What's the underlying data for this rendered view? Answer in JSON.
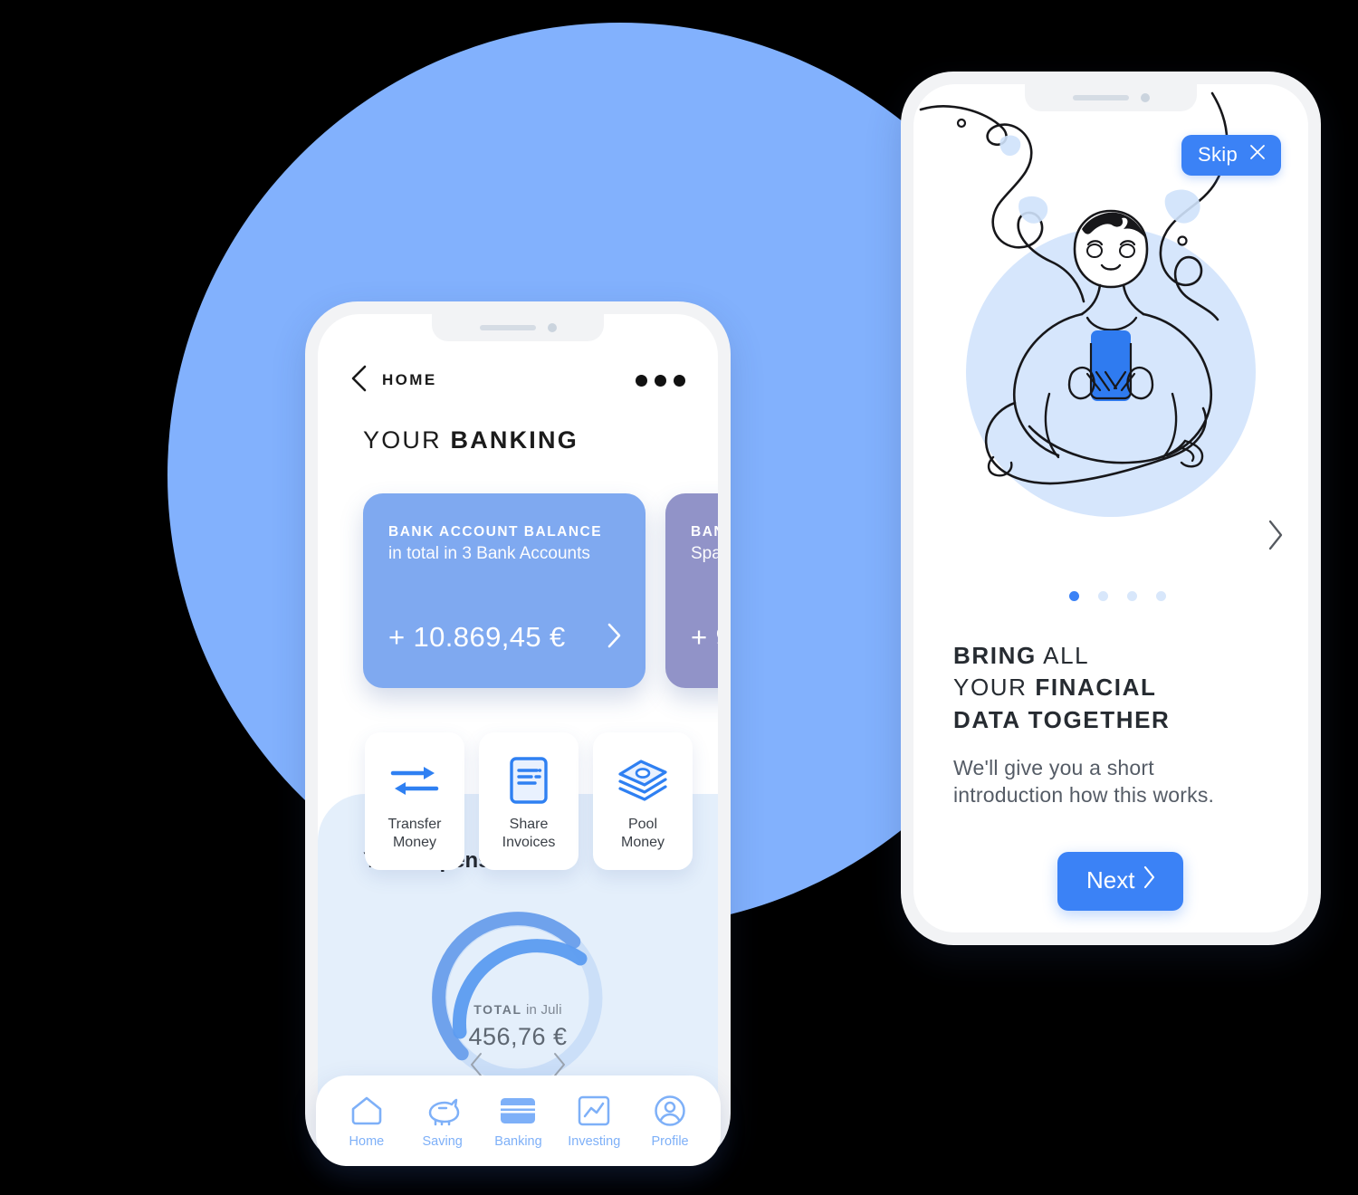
{
  "colors": {
    "bg_circle": "#82B1FD",
    "card_blue": "#7FA9F0",
    "card_purple": "#9193C8",
    "accent_blue": "#3B82F6",
    "nav_blue": "#7EB0F8",
    "panel_light": "#E4EFFB"
  },
  "left_phone": {
    "topbar": {
      "back_icon": "chevron-left-icon",
      "title": "HOME",
      "menu_icon": "more-dots-icon"
    },
    "section_heading": {
      "light": "YOUR",
      "bold": "BANKING"
    },
    "cards": [
      {
        "title": "BANK ACCOUNT BALANCE",
        "subtitle": "in total in 3 Bank Accounts",
        "amount": "+ 10.869,45 €",
        "arrow_icon": "chevron-right-icon",
        "color": "#7FA9F0"
      },
      {
        "title": "BAN",
        "subtitle": "Spa",
        "amount": "+ 9",
        "arrow_icon": "chevron-right-icon",
        "color": "#9193C8"
      }
    ],
    "actions": [
      {
        "icon": "transfer-arrows-icon",
        "line1": "Transfer",
        "line2": "Money"
      },
      {
        "icon": "invoice-document-icon",
        "line1": "Share",
        "line2": "Invoices"
      },
      {
        "icon": "money-stack-icon",
        "line1": "Pool",
        "line2": "Money"
      }
    ],
    "expenses": {
      "title_light": "Your ",
      "title_bold": "Expenses",
      "total_label": "TOTAL",
      "period": "in Juli",
      "amount": "456,76 €",
      "prev_icon": "chevron-left-icon",
      "next_icon": "chevron-right-icon"
    },
    "bottom_nav": [
      {
        "icon": "home-icon",
        "label": "Home"
      },
      {
        "icon": "piggy-bank-icon",
        "label": "Saving"
      },
      {
        "icon": "credit-card-icon",
        "label": "Banking"
      },
      {
        "icon": "chart-line-icon",
        "label": "Investing"
      },
      {
        "icon": "profile-avatar-icon",
        "label": "Profile"
      }
    ]
  },
  "right_phone": {
    "skip_button": {
      "label": "Skip",
      "icon": "close-x-icon"
    },
    "illustration": "meditating-person-with-phone-illustration",
    "carousel_next_icon": "chevron-right-icon",
    "dots": {
      "count": 4,
      "active_index": 0
    },
    "headline": {
      "l1_bold": "BRING",
      "l1_light": " ALL",
      "l2_light": "YOUR ",
      "l2_bold": "FINACIAL",
      "l3_bold": "DATA TOGETHER"
    },
    "subtext": "We'll give you a short introduction how this works.",
    "next_button": {
      "label": "Next",
      "icon": "chevron-right-icon"
    }
  }
}
